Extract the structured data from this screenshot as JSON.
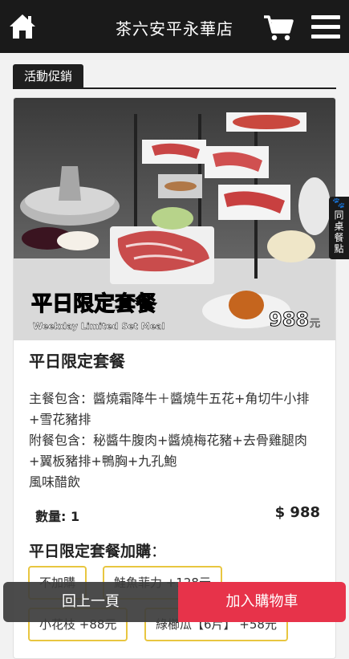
{
  "header": {
    "title": "茶六安平永華店",
    "home_icon": "home-icon",
    "cart_icon": "cart-icon",
    "menu_icon": "hamburger-menu-icon"
  },
  "section": {
    "label": "活動促銷"
  },
  "product": {
    "photo_title": "平日限定套餐",
    "photo_subtitle": "Weekday Limited Set Meal",
    "photo_price": "988",
    "photo_price_unit": "元",
    "name": "平日限定套餐",
    "description_lines": [
      "主餐包含：醬燒霜降牛＋醬燒牛五花+角切牛小排+雪花豬排",
      "附餐包含：秘醬牛腹肉+醬燒梅花豬+去骨雞腿肉+翼板豬排+鴨胸+九孔鮑",
      "風味醋飲"
    ],
    "quantity_label": "數量: 1",
    "price": "$ 988"
  },
  "addons": {
    "title": "平日限定套餐加購",
    "colon": "：",
    "options": [
      "不加購",
      "鮭魚菲力 +128元",
      "小花枝 +88元",
      "綠櫛瓜【6片】 +58元"
    ]
  },
  "side_tab": {
    "chars": [
      "同",
      "桌",
      "餐",
      "點"
    ],
    "icon": "paw-icon"
  },
  "footer": {
    "back_label": "回上一頁",
    "add_to_cart_label": "加入購物車"
  },
  "colors": {
    "header_bg": "#1a1a1a",
    "chip_border": "#e8c640",
    "add_button": "#e7334a",
    "back_button": "#3c3c3c"
  }
}
